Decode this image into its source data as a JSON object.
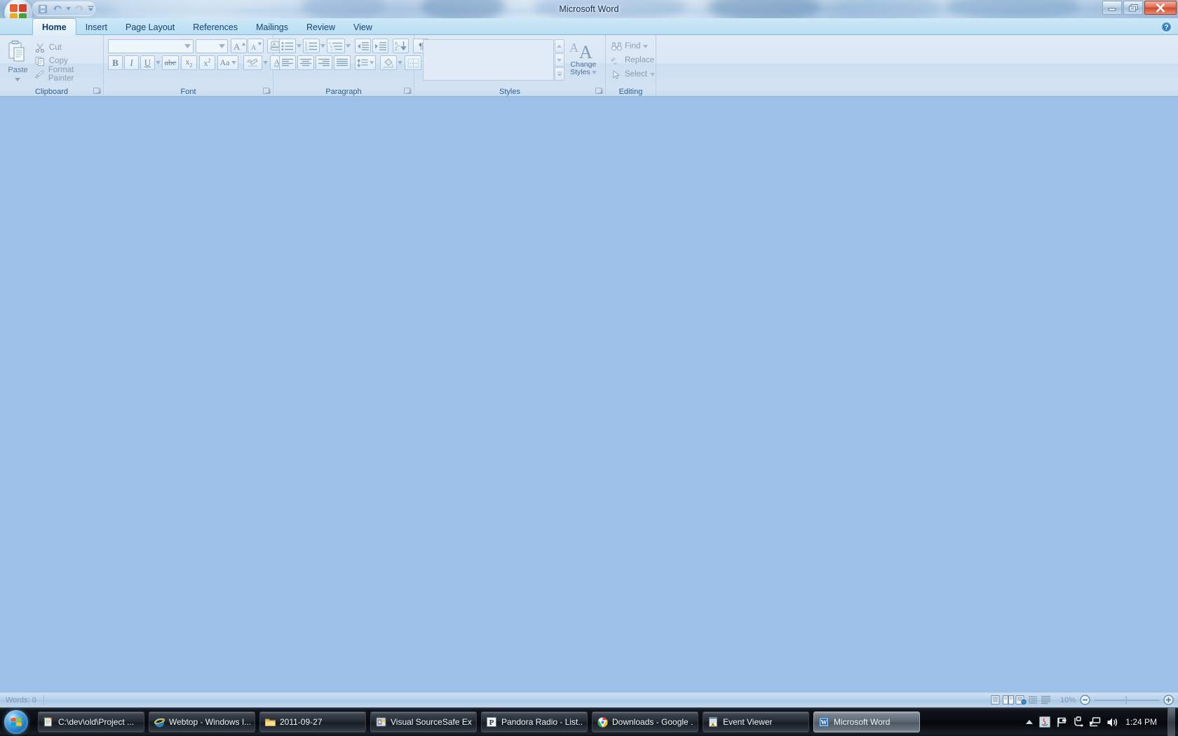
{
  "window": {
    "title": "Microsoft Word",
    "controls": {
      "minimize": "Minimize",
      "maximize": "Restore Down",
      "close": "Close"
    },
    "quick_access": {
      "save": "Save",
      "undo": "Undo",
      "redo": "Repeat",
      "customize": "Customize Quick Access Toolbar"
    },
    "office_button": "Office Button",
    "help": "Microsoft Office Word Help"
  },
  "ribbon": {
    "tabs": [
      {
        "label": "Home",
        "active": true
      },
      {
        "label": "Insert",
        "active": false
      },
      {
        "label": "Page Layout",
        "active": false
      },
      {
        "label": "References",
        "active": false
      },
      {
        "label": "Mailings",
        "active": false
      },
      {
        "label": "Review",
        "active": false
      },
      {
        "label": "View",
        "active": false
      }
    ],
    "clipboard": {
      "label": "Clipboard",
      "paste": "Paste",
      "cut": "Cut",
      "copy": "Copy",
      "format_painter": "Format Painter",
      "dialog_launcher": "Clipboard Dialog Box Launcher"
    },
    "font": {
      "label": "Font",
      "font_name_value": "",
      "font_name_placeholder": "",
      "font_size_value": "",
      "font_size_placeholder": "",
      "grow_font": "Grow Font",
      "shrink_font": "Shrink Font",
      "clear_formatting": "Clear Formatting",
      "bold": "B",
      "italic": "I",
      "underline": "U",
      "strikethrough": "abe",
      "subscript": "X₂",
      "superscript": "X²",
      "change_case": "Aa",
      "text_highlight": "Text Highlight Color",
      "font_color": "Font Color",
      "dialog_launcher": "Font Dialog Box Launcher"
    },
    "paragraph": {
      "label": "Paragraph",
      "bullets": "Bullets",
      "numbering": "Numbering",
      "multilevel_list": "Multilevel List",
      "decrease_indent": "Decrease Indent",
      "increase_indent": "Increase Indent",
      "sort": "Sort",
      "show_marks": "¶",
      "align_left": "Align Text Left",
      "center": "Center",
      "align_right": "Align Text Right",
      "justify": "Justify",
      "line_spacing": "Line Spacing",
      "shading": "Shading",
      "borders": "Borders",
      "dialog_launcher": "Paragraph Dialog Box Launcher"
    },
    "styles": {
      "label": "Styles",
      "gallery_items": [],
      "change_styles_line1": "Change",
      "change_styles_line2": "Styles",
      "scroll_up": "Row Up",
      "scroll_down": "Row Down",
      "more": "More",
      "dialog_launcher": "Styles Dialog Box Launcher"
    },
    "editing": {
      "label": "Editing",
      "find": "Find",
      "replace": "Replace",
      "select": "Select"
    }
  },
  "status_bar": {
    "words": "Words: 0",
    "zoom_level": "10%",
    "zoom_out": "Zoom Out",
    "zoom_in": "Zoom In",
    "views": [
      "Print Layout",
      "Full Screen Reading",
      "Web Layout",
      "Outline",
      "Draft"
    ]
  },
  "taskbar": {
    "start": "Start",
    "buttons": [
      {
        "label": "C:\\dev\\old\\Project ...",
        "icon": "notepad-icon",
        "active": false
      },
      {
        "label": "Webtop - Windows I...",
        "icon": "internet-explorer-icon",
        "active": false
      },
      {
        "label": "2011-09-27",
        "icon": "folder-icon",
        "active": false
      },
      {
        "label": "Visual SourceSafe Ex...",
        "icon": "sourcesafe-icon",
        "active": false
      },
      {
        "label": "Pandora Radio - List...",
        "icon": "pandora-icon",
        "active": false
      },
      {
        "label": "Downloads - Google ...",
        "icon": "chrome-icon",
        "active": false
      },
      {
        "label": "Event Viewer",
        "icon": "event-viewer-icon",
        "active": false
      },
      {
        "label": "Microsoft Word",
        "icon": "word-icon",
        "active": true
      }
    ],
    "tray": {
      "show_hidden": "Show hidden icons",
      "icons": [
        "java-icon",
        "flag-action-center-icon",
        "safely-remove-hardware-icon",
        "network-icon",
        "volume-icon"
      ],
      "clock": "1:24 PM",
      "show_desktop": "Show desktop"
    }
  },
  "colors": {
    "canvas": "#9dc0e8",
    "ribbon_bg": "#d6e4f3",
    "tab_strip": "#c2e3f6",
    "accent_text": "#15436e",
    "disabled_text": "#879db2",
    "taskbar": "#0a0d12",
    "close_button": "#cf4a2c"
  }
}
